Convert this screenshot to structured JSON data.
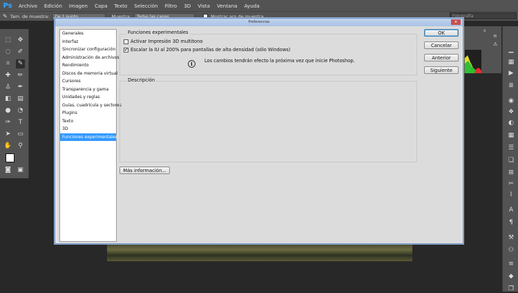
{
  "app": {
    "logo": "Ps"
  },
  "menubar": {
    "items": [
      "Archivo",
      "Edición",
      "Imagen",
      "Capa",
      "Texto",
      "Selección",
      "Filtro",
      "3D",
      "Vista",
      "Ventana",
      "Ayuda"
    ]
  },
  "options": {
    "sample_size_label": "Tam. de muestra:",
    "sample_size_value": "De 1 punto",
    "sample_label": "Muestra:",
    "sample_value": "Todas las capas",
    "ring_label": "Mostrar aro de muestra",
    "workspace": "Fotografía"
  },
  "dialog": {
    "title": "Preferencias",
    "close": "x",
    "categories": [
      "Generales",
      "Interfaz",
      "Sincronizar configuración",
      "Administración de archivos",
      "Rendimiento",
      "Discos de memoria virtual",
      "Cursores",
      "Transparencia y gama",
      "Unidades y reglas",
      "Guías, cuadrícula y sectores",
      "Plugins",
      "Texto",
      "3D",
      "Funciones experimentales"
    ],
    "selected_category": 13,
    "experimental": {
      "title": "Funciones experimentales",
      "option1": "Activar Impresión 3D multitono",
      "option1_checked": false,
      "option2": "Escalar la IU al 200% para pantallas de alta densidad (sólo Windows)",
      "option2_checked": true,
      "info_icon": "i",
      "info_text": "Los cambios tendrán efecto la próxima vez que inicie Photoshop."
    },
    "description": {
      "title": "Descripción"
    },
    "more_info_button": "Más información...",
    "buttons": {
      "ok": "OK",
      "cancel": "Cancelar",
      "prev": "Anterior",
      "next": "Siguiente"
    }
  },
  "panel": {
    "close": "x",
    "menu": "≡"
  }
}
